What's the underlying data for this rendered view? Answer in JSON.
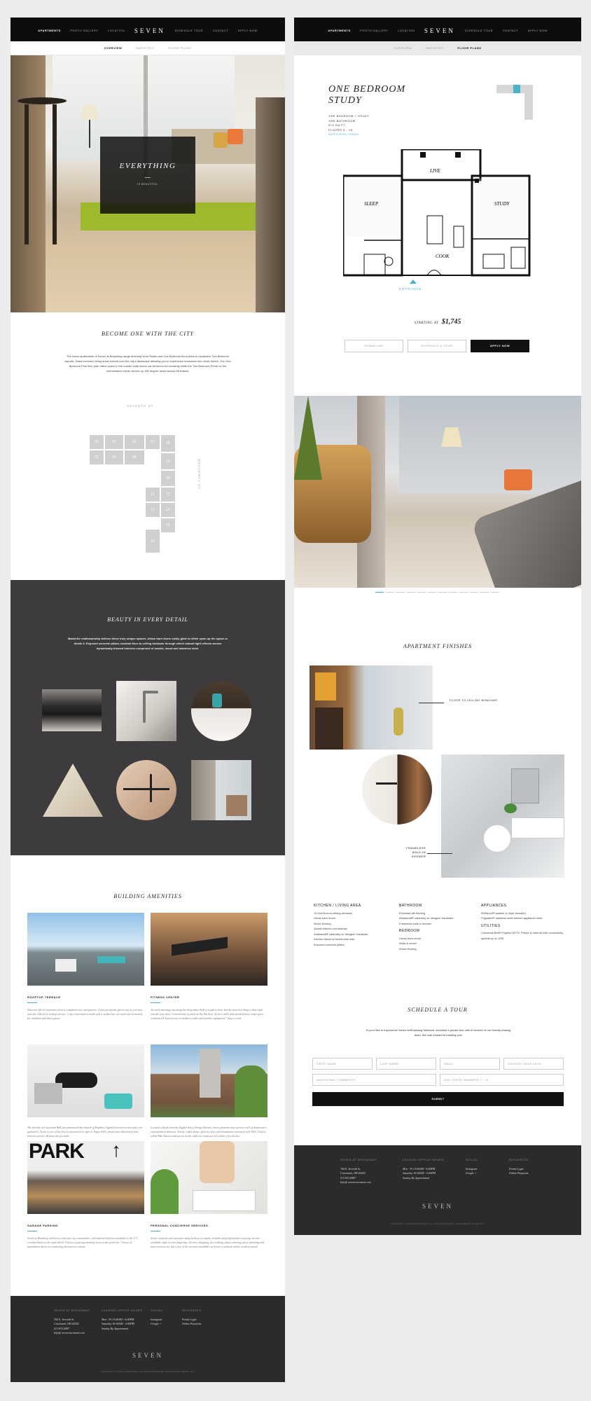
{
  "nav": {
    "left_items": [
      "APARTMENTS",
      "PHOTO GALLERY",
      "LOCATION"
    ],
    "logo": "SEVEN",
    "right_items": [
      "SCHEDULE TOUR",
      "CONTACT",
      "APPLY NOW"
    ],
    "sub_items": [
      "OVERVIEW",
      "AMENITIES",
      "FLOOR PLANS"
    ]
  },
  "left": {
    "hero": {
      "title": "EVERYTHING",
      "subtitle": "IS BEAUTIFUL"
    },
    "city": {
      "title": "BECOME ONE WITH THE CITY",
      "text": "The iconic apartments of Seven at Broadway range diversely from Studio and One Bedroom floor plans to expansive Two Bedroom layouts. Glass enclosed living areas extend over the city's landscape allowing you to experience downtown like never before. Our One Bedroom Plus floor plan offers space in the master suite where car-bedroom-for-creativity while the Two Bedroom Prime on the northeastern corner serves up 180 degree views across Mt Adams.",
      "street_top": "SEVENTH ST.",
      "street_side": "BROADWAY ST.",
      "units": [
        "01",
        "02",
        "03",
        "07",
        "08",
        "02",
        "04",
        "06",
        "10",
        "09",
        "11",
        "12",
        "13",
        "14",
        "15",
        "16"
      ]
    },
    "detail": {
      "title": "BEAUTY IN EVERY DETAIL",
      "text": "Masterful craftsmanship defines these truly unique spaces. Urban barn doors easily glide to either open up the space or divide it. Exposed concrete pillars contrast floor-to-ceiling windows through which natural light reflects across dynamically-themed interiors comprised of marble, wood and stainless steel."
    },
    "amenities": {
      "title": "BUILDING AMENITIES",
      "items": [
        {
          "name": "ROOFTOP TERRACE",
          "text": "Discover life in Cincinnati from a completely new perspective. A fire pit warmly greets you as you step onto the 16th floor rooftop terrace. Cozy conversation nooks and a sunken bar are reserved exclusively for residents and their guests."
        },
        {
          "name": "FITNESS CENTER",
          "text": "An early morning run along the Serpentine Wall is tough to beat, but the next best thing is that right outside your door. Conveniently located on the 9th floor, Seven's sleek and stylish fitness center gives residents 24-hour access to modern cardio and aerobic equipment 7 days a week."
        },
        {
          "name": "",
          "text": "The fireside at Cincinnati Bell just announced the launch of Hopkins Gigabit Internet service and, you guessed it, Seven is one of the first in downtown to offer it. Enjoy WiFi, phone and ridiculously fast internet service all from one provider."
        },
        {
          "name": "",
          "text": "Located a block from the Eighth Street Design District, Seven presents easy access to all of downtown's entertainment districts. Trendy coffee shops, grocers, bars and restaurants surround with P&G Towers, a Red Bike Station and access to the cable car stops are all within a few blocks."
        },
        {
          "name": "GARAGE PARKING",
          "text": "Seven at Broadway delivers to and suit city convenience with metered and not available to the 171 certified bank on the same block. 8 floors of garage parking serve as the perch for 7 floors of apartments above in connecting downtown's streets."
        },
        {
          "name": "PERSONAL CONCIERGE SERVICES",
          "text": "Seven residents can outsource daily tasks to a trusted, reliable and professional concierge service available right at your fingertips. Grocery shopping, pet walking, plant watering, party planning and most services are just a few of the services available on Seven's exclusive online resident portal."
        }
      ],
      "park_sign": "PARK"
    }
  },
  "footer": {
    "col1_head": "SEVEN AT BROADWAY",
    "col1": [
      "760 E. Seventh St.",
      "Cincinnati, OH 45202",
      "513.833.6987",
      "Info@ sevencincinnati.com"
    ],
    "col2_head": "LEASING OFFICE HOURS",
    "col2": [
      "Mon - Fri   9:00AM - 6:00PM",
      "Saturday   10:00AM - 4:00PM",
      "Sunday   By Appointment"
    ],
    "col3_head": "SOCIAL",
    "col3": [
      "Instagram",
      "Google +"
    ],
    "col4_head": "RESIDENTS",
    "col4": [
      "Portal Login",
      "Online Payments"
    ],
    "logo": "SEVEN",
    "copyright": "COPYRIGHT © SEVEN AT BROADWAY. ALL RIGHTS RESERVED. DEVELOPED BY NEYER, INC."
  },
  "right": {
    "plan": {
      "title": "ONE BEDROOM STUDY",
      "specs": [
        "ONE BEDROOM + STUDY",
        "ONE BATHROOM",
        "974 SQ FT",
        "FLOORS 9 - 15"
      ],
      "view": "NORTHERN VIEWS",
      "rooms": [
        "LIVE",
        "SLEEP",
        "STUDY",
        "COOK"
      ],
      "entrance": "ENTRANCE",
      "price_label": "STARTING AT",
      "price": "$1,745",
      "buttons": [
        "DOWNLOAD",
        "SCHEDULE A TOUR",
        "APPLY NOW"
      ]
    },
    "finishes": {
      "title": "APARTMENT FINISHES",
      "callout1": "FLOOR TO CEILING WINDOWS",
      "callout2": "FRAMELESS WALK-IN SHOWER",
      "kitchen_head": "KITCHEN / LIVING AREA",
      "kitchen": [
        "10 foot floor-to-ceiling windows",
        "Urban barn doors",
        "Wood flooring",
        "Quartz kitchen countertops",
        "Aristokraft® cabinetry w/ designer hardware",
        "Kitchen island w/ farmhouse sink",
        "Exposed concrete pillars"
      ],
      "bath_head": "BATHROOM",
      "bath": [
        "Porcelain tile flooring",
        "Aristokraft® cabinetry w/ designer hardware",
        "Frameless walk in shower"
      ],
      "bed_head": "BEDROOM",
      "bed": [
        "Urban barn doors",
        "Walk-in closet",
        "Wood flooring"
      ],
      "app_head": "APPLIANCES",
      "app": [
        "Whirlpool® washer & dryer included",
        "Frigidaire® stainless steel kitchen appliance suite"
      ],
      "util_head": "UTILITIES",
      "util": [
        "Cincinnati Bell® Fioptics HDTV, Phone & Internet with connectivity speeds up to 1GB"
      ]
    },
    "tour": {
      "title": "SCHEDULE A TOUR",
      "text": "If you'd like to experience Seven at Broadway firsthand, schedule a private tour with a member of our friendly leasing team. We look forward to meeting you!",
      "fields": [
        "FIRST NAME",
        "LAST NAME",
        "EMAIL",
        "CHOOSE TOUR DATE"
      ],
      "comments": "ADDITIONAL COMMENTS",
      "captcha": "ADD THESE NUMBERS 7 + 8",
      "submit": "SUBMIT"
    }
  }
}
